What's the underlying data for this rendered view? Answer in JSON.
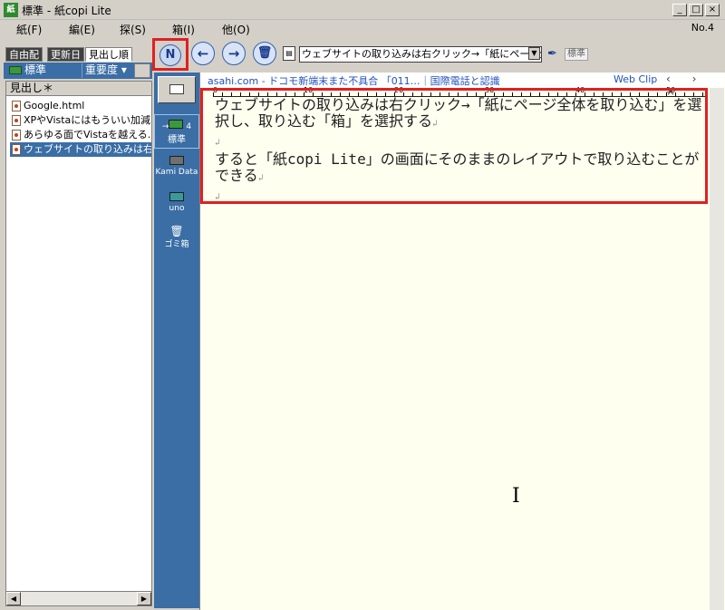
{
  "window": {
    "title": "標準 - 紙copi Lite",
    "app_icon": "紙",
    "buttons": {
      "minimize": "_",
      "maximize": "□",
      "close": "×"
    }
  },
  "menu": {
    "items": [
      "紙(F)",
      "編(E)",
      "探(S)",
      "箱(I)",
      "他(O)"
    ],
    "page_number": "No.4"
  },
  "left_panel": {
    "tabs": [
      "自由配",
      "更新日",
      "見出し順"
    ],
    "folder_label": "標準",
    "sort_label": "重要度 ▾",
    "list_header": "見出し＊",
    "items": [
      {
        "label": "Google.html",
        "selected": false
      },
      {
        "label": "XPやVistaにはもういい加減",
        "selected": false
      },
      {
        "label": "あらゆる面でVistaを越える...",
        "selected": false
      },
      {
        "label": "ウェブサイトの取り込みは右",
        "selected": true
      }
    ]
  },
  "toolbar": {
    "new_icon": "N",
    "back_icon": "←",
    "forward_icon": "→",
    "trash_icon": "🗑",
    "title_field": "ウェブサイトの取り込みは右クリック→「紙にページ全体",
    "style_label": "標準"
  },
  "boxes": [
    {
      "label": "標準",
      "count": "4",
      "selected": true,
      "color": "#3a9a3a"
    },
    {
      "label": "Kami Data",
      "count": "",
      "selected": false,
      "color": "#707070"
    },
    {
      "label": "uno",
      "count": "",
      "selected": false,
      "color": "#3a9a9a"
    },
    {
      "label": "ゴミ箱",
      "count": "",
      "selected": false,
      "color": "#d4d0c8"
    }
  ],
  "editor": {
    "clip_link": "asahi.com - ドコモ新端末また不具合 「011…｜国際電話と認識",
    "webclip_label": "Web Clip",
    "ruler_labels": [
      "0",
      "10",
      "20",
      "30",
      "40",
      "50"
    ],
    "paragraphs": [
      "ウェブサイトの取り込みは右クリック→「紙にページ全体を取り込む」を選択し、取り込む「箱」を選択する",
      "",
      "すると「紙copi Lite」の画面にそのままのレイアウトで取り込むことができる",
      ""
    ]
  }
}
